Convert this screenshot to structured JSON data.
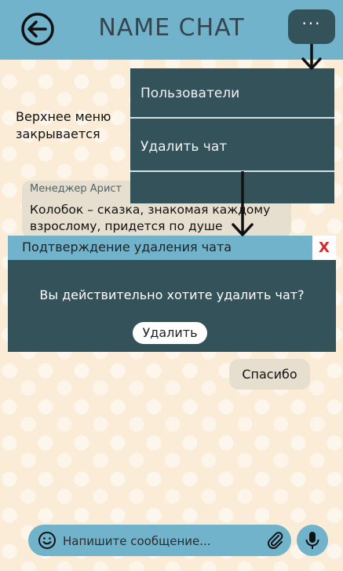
{
  "header": {
    "title": "NAME CHAT",
    "back_icon": "arrow-left-circle-icon",
    "more_icon": "ellipsis-icon",
    "more_label": "···"
  },
  "menu": {
    "items": [
      {
        "label": "Пользователи"
      },
      {
        "label": "Удалить чат"
      }
    ]
  },
  "annotation": {
    "line1": "Верхнее меню",
    "line2": "закрывается"
  },
  "message": {
    "author": "Менеджер Арист",
    "text": "Колобок – сказка, знакомая каждому взрослому, придется по душе"
  },
  "dialog": {
    "title": "Подтверждение удаления чата",
    "close_label": "X",
    "question": "Вы действительно хотите удалить чат?",
    "confirm_label": "Удалить"
  },
  "reply": {
    "text": "Спасибо"
  },
  "composer": {
    "placeholder": "Напишите сообщение...",
    "emoji_icon": "smile-icon",
    "attach_icon": "paperclip-icon",
    "mic_icon": "microphone-icon"
  },
  "colors": {
    "accent": "#72b3cc",
    "dark": "#34525a",
    "background": "#fbecd8",
    "bubble": "#e6dfcf",
    "close_red": "#d62b2b"
  }
}
